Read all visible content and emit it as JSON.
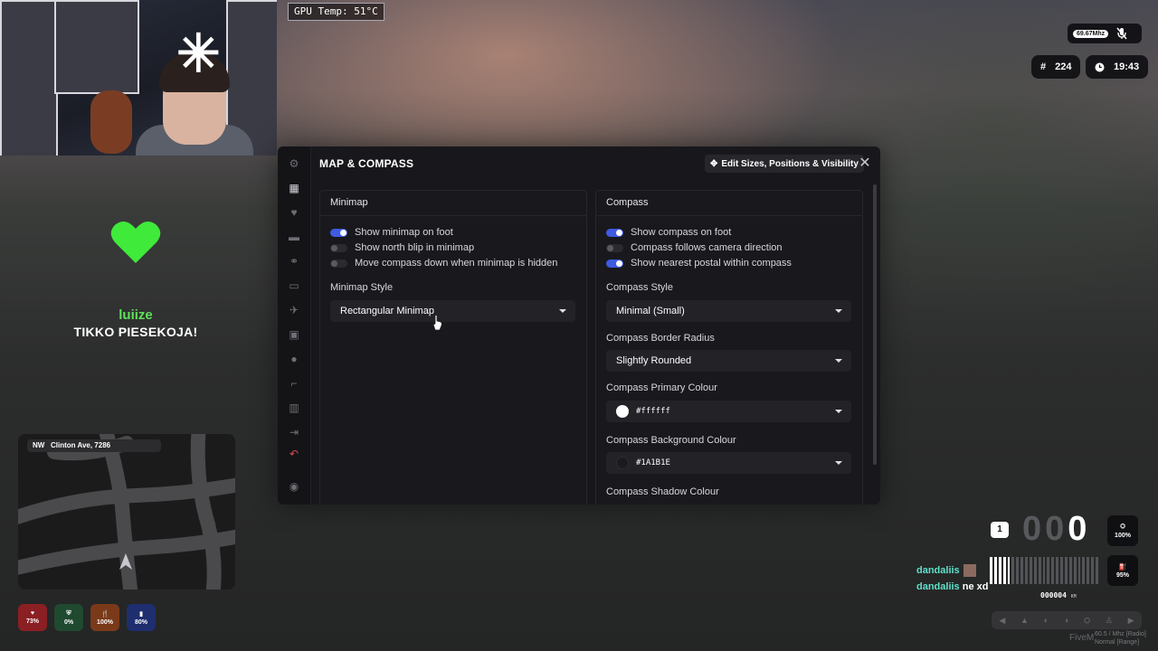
{
  "overlay": {
    "gpu_temp": "GPU Temp: 51°C",
    "mhz": "69.67Mhz",
    "players": "224",
    "clock": "19:43",
    "player_name": "luiize",
    "player_message": "TIKKO PIESEKOJA!"
  },
  "minimap": {
    "direction": "NW",
    "street": "Clinton Ave, 7286"
  },
  "status": [
    {
      "value": "73%",
      "color": "#8a1f24",
      "icon": "heart-icon"
    },
    {
      "value": "0%",
      "color": "#1f4a30",
      "icon": "shield-icon"
    },
    {
      "value": "100%",
      "color": "#7a3a1a",
      "icon": "food-icon"
    },
    {
      "value": "80%",
      "color": "#1e2e6e",
      "icon": "water-icon"
    }
  ],
  "panel": {
    "title": "MAP & COMPASS",
    "edit_button": "Edit Sizes, Positions & Visibility",
    "minimap": {
      "heading": "Minimap",
      "toggles": [
        {
          "label": "Show minimap on foot",
          "on": true
        },
        {
          "label": "Show north blip in minimap",
          "on": false
        },
        {
          "label": "Move compass down when minimap is hidden",
          "on": false
        }
      ],
      "style_label": "Minimap Style",
      "style_value": "Rectangular Minimap"
    },
    "compass": {
      "heading": "Compass",
      "toggles": [
        {
          "label": "Show compass on foot",
          "on": true
        },
        {
          "label": "Compass follows camera direction",
          "on": false
        },
        {
          "label": "Show nearest postal within compass",
          "on": true
        }
      ],
      "style_label": "Compass Style",
      "style_value": "Minimal (Small)",
      "radius_label": "Compass Border Radius",
      "radius_value": "Slightly Rounded",
      "primary_label": "Compass Primary Colour",
      "primary_value": "#ffffff",
      "background_label": "Compass Background Colour",
      "background_value": "#1A1B1E",
      "shadow_label": "Compass Shadow Colour"
    },
    "accent_color": "#3f5be0"
  },
  "vehicle": {
    "gear": "1",
    "speed_dim": "00",
    "speed_lit": "0",
    "engine": "100%",
    "fuel": "95%",
    "odometer": "000004",
    "odometer_unit": "KM"
  },
  "chat": [
    {
      "name": "dandaliis",
      "text": ""
    },
    {
      "name": "dandaliis",
      "text": "ne xd"
    }
  ],
  "watermark": "FiveM",
  "watermark_small": [
    "60.5 / Mhz [Radio]",
    "Normal [Range]"
  ]
}
